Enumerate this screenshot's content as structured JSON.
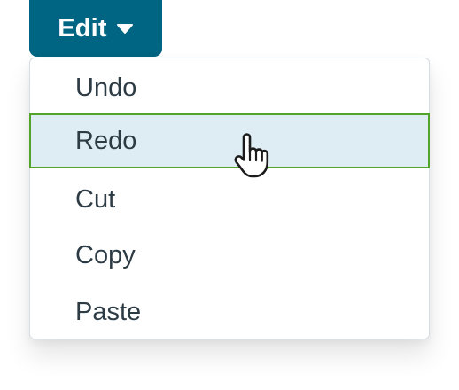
{
  "edit_menu": {
    "button_label": "Edit",
    "caret_icon": "triangle-down-icon",
    "items": [
      {
        "label": "Undo"
      },
      {
        "label": "Redo",
        "hovered": true
      },
      {
        "label": "Cut"
      },
      {
        "label": "Copy"
      },
      {
        "label": "Paste"
      }
    ]
  },
  "pointer": {
    "icon": "hand-pointer-icon"
  },
  "colors": {
    "button_background": "#006582",
    "button_text": "#ffffff",
    "menu_text": "#2d3b45",
    "hover_background": "#ddedf3",
    "hover_border": "#52a52a",
    "menu_border": "#d7dde2"
  }
}
